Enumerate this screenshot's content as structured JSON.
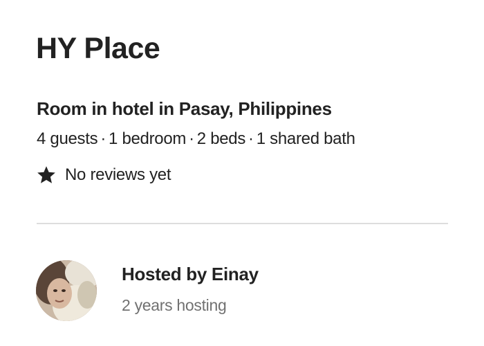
{
  "listing": {
    "title": "HY Place",
    "type": "Room in hotel in Pasay, Philippines",
    "details": {
      "guests": "4 guests",
      "bedrooms": "1 bedroom",
      "beds": "2 beds",
      "baths": "1 shared bath",
      "separator": "·"
    },
    "reviews": {
      "icon": "star-icon",
      "text": "No reviews yet"
    }
  },
  "host": {
    "avatar_icon": "avatar",
    "name_label": "Hosted by Einay",
    "experience": "2 years hosting"
  }
}
